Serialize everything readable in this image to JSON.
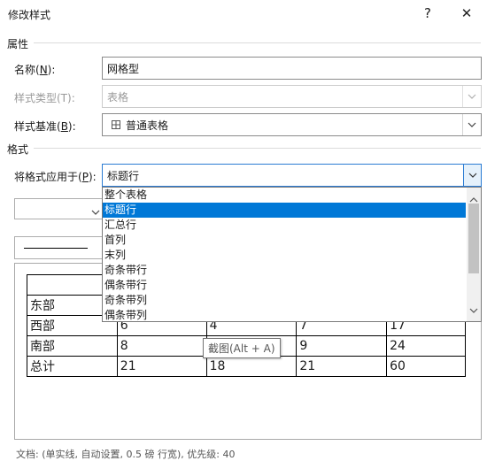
{
  "window": {
    "title": "修改样式",
    "help_glyph": "?",
    "close_glyph": "✕"
  },
  "properties": {
    "section_label": "属性",
    "name": {
      "label": "名称(N):",
      "label_pre": "名称(",
      "label_key": "N",
      "label_post": "):",
      "value": "网格型"
    },
    "style_type": {
      "label": "样式类型(T):",
      "value": "表格"
    },
    "based_on": {
      "label": "样式基准(B):",
      "label_pre": "样式基准(",
      "label_key": "B",
      "label_post": "):",
      "value": "普通表格",
      "icon": "table-grid-icon"
    }
  },
  "format": {
    "section_label": "格式",
    "apply_to": {
      "label": "将格式应用于(P):",
      "label_pre": "将格式应用于(",
      "label_key": "P",
      "label_post": "):",
      "value": "标题行"
    },
    "apply_options": [
      "整个表格",
      "标题行",
      "汇总行",
      "首列",
      "末列",
      "奇条带行",
      "偶条带行",
      "奇条带列",
      "偶条带列"
    ],
    "selected_index": 1
  },
  "preview": {
    "rows": [
      [
        "",
        "",
        "",
        "",
        ""
      ],
      [
        "东部",
        "",
        "",
        "",
        ""
      ],
      [
        "西部",
        "6",
        "4",
        "7",
        "17"
      ],
      [
        "南部",
        "8",
        "",
        "9",
        "24"
      ],
      [
        "总计",
        "21",
        "18",
        "21",
        "60"
      ]
    ]
  },
  "tooltip": {
    "text": "截图(Alt + A)"
  },
  "status": {
    "text": "文档: (单实线, 自动设置,  0.5 磅 行宽), 优先级: 40"
  },
  "colors": {
    "selection": "#0078d7",
    "focus_border": "#2b7cd3"
  }
}
